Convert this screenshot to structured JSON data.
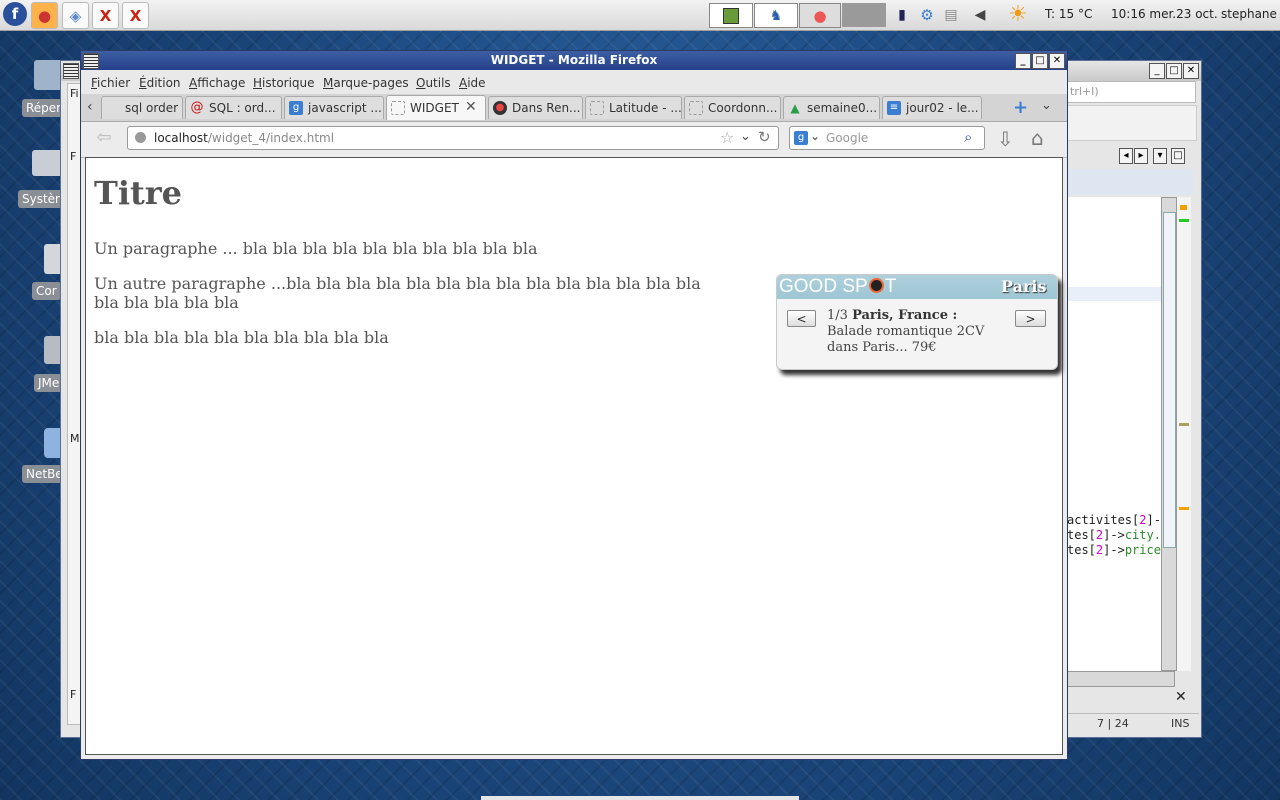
{
  "panel": {
    "weather": "T: 15 °C",
    "clock": "10:16 mer.23 oct.",
    "user": "stephane"
  },
  "desktop": {
    "icons": [
      {
        "label": "Répert"
      },
      {
        "label": "Systèm"
      },
      {
        "label": "Cor"
      },
      {
        "label": "JMe"
      },
      {
        "label": "NetBe"
      }
    ]
  },
  "background_window": {
    "search_hint": "trl+I)",
    "code_lines": [
      {
        "pre": "activites[",
        "num": "2",
        "post": "]->"
      },
      {
        "pre": "tes[",
        "num": "2",
        "post": "]->",
        "tail": "city."
      },
      {
        "pre": "tes[",
        "num": "2",
        "post": "]->",
        "tail": "price"
      }
    ],
    "status_pos": "7 | 24",
    "status_mode": "INS",
    "side_letters": [
      "Fi",
      "F",
      "F",
      "M",
      "F"
    ]
  },
  "firefox": {
    "title": "WIDGET - Mozilla Firefox",
    "menus": [
      {
        "key": "F",
        "rest": "ichier"
      },
      {
        "key": "É",
        "rest": "dition"
      },
      {
        "key": "A",
        "rest": "ffichage"
      },
      {
        "key": "H",
        "rest": "istorique"
      },
      {
        "key": "M",
        "rest": "arque-pages"
      },
      {
        "key": "O",
        "rest": "utils"
      },
      {
        "key": "A",
        "rest": "ide"
      }
    ],
    "tabs": [
      {
        "label": "sql order ..."
      },
      {
        "label": "SQL : ord..."
      },
      {
        "label": "javascript ..."
      },
      {
        "label": "WIDGET"
      },
      {
        "label": "Dans Ren..."
      },
      {
        "label": "Latitude - ..."
      },
      {
        "label": "Coordonn..."
      },
      {
        "label": "semaine0..."
      },
      {
        "label": "jour02 - le..."
      }
    ],
    "url_host": "localhost",
    "url_path": "/widget_4/index.html",
    "search_placeholder": "Google"
  },
  "page": {
    "heading": "Titre",
    "para1": "Un paragraphe ... bla bla bla bla bla bla bla bla bla bla",
    "para2_line1": "Un autre paragraphe ...bla bla bla bla bla bla bla bla bla bla bla bla bla bla",
    "para2_line2": "bla bla bla bla bla",
    "para3": "bla bla bla bla bla bla bla bla bla bla"
  },
  "widget": {
    "logo_a": "GOOD SP",
    "logo_b": "T",
    "city": "Paris",
    "counter": "1/3",
    "place": "Paris, France :",
    "desc": "Balade romantique 2CV dans Paris...",
    "price": "79€",
    "prev_label": "<",
    "next_label": ">"
  }
}
